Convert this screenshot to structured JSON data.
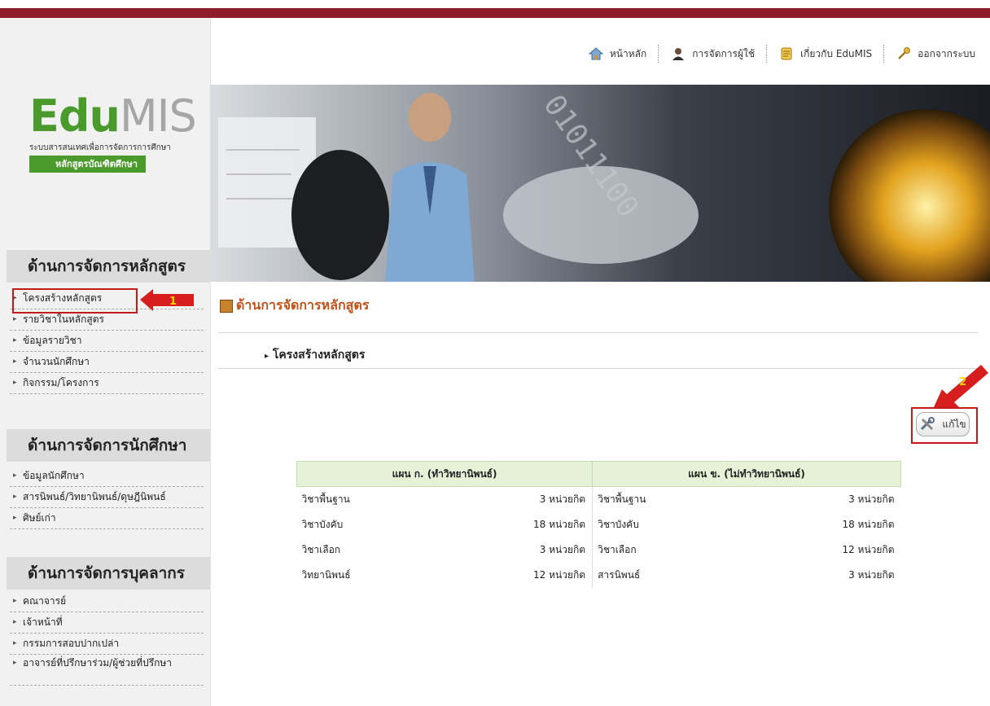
{
  "logo": {
    "brand_a": "Edu",
    "brand_b": "MIS",
    "tagline": "ระบบสารสนเทศเพื่อการจัดการการศึกษา",
    "program": "หลักสูตรบัณฑิตศึกษา"
  },
  "nav": {
    "home": "หน้าหลัก",
    "users": "การจัดการผู้ใช้",
    "about": "เกี่ยวกับ EduMIS",
    "logout": "ออกจากระบบ"
  },
  "sidebar": {
    "sec1": {
      "title": "ด้านการจัดการหลักสูตร",
      "items": [
        "โครงสร้างหลักสูตร",
        "รายวิชาในหลักสูตร",
        "ข้อมูลรายวิชา",
        "จำนวนนักศึกษา",
        "กิจกรรม/โครงการ"
      ]
    },
    "sec2": {
      "title": "ด้านการจัดการนักศึกษา",
      "items": [
        "ข้อมูลนักศึกษา",
        "สารนิพนธ์/วิทยานิพนธ์/ดุษฎีนิพนธ์",
        "ศิษย์เก่า"
      ]
    },
    "sec3": {
      "title": "ด้านการจัดการบุคลากร",
      "items": [
        "คณาจารย์",
        "เจ้าหน้าที่",
        "กรรมการสอบปากเปล่า",
        "อาจารย์ที่ปรึกษาร่วม/ผู้ช่วยที่ปรึกษา"
      ]
    }
  },
  "main": {
    "section_title": "ด้านการจัดการหลักสูตร",
    "subtitle": "โครงสร้างหลักสูตร",
    "edit_label": "แก้ไข"
  },
  "annotations": {
    "one": "1",
    "two": "2"
  },
  "plan_table": {
    "headers": [
      "แผน ก. (ทำวิทยานิพนธ์)",
      "แผน ข. (ไม่ทำวิทยานิพนธ์)"
    ],
    "rows": [
      {
        "a_label": "วิชาพื้นฐาน",
        "a_val": "3 หน่วยกิต",
        "b_label": "วิชาพื้นฐาน",
        "b_val": "3 หน่วยกิต"
      },
      {
        "a_label": "วิชาบังคับ",
        "a_val": "18 หน่วยกิต",
        "b_label": "วิชาบังคับ",
        "b_val": "18 หน่วยกิต"
      },
      {
        "a_label": "วิชาเลือก",
        "a_val": "3 หน่วยกิต",
        "b_label": "วิชาเลือก",
        "b_val": "12 หน่วยกิต"
      },
      {
        "a_label": "วิทยานิพนธ์",
        "a_val": "12 หน่วยกิต",
        "b_label": "สารนิพนธ์",
        "b_val": "3 หน่วยกิต"
      }
    ]
  },
  "colors": {
    "topbar": "#8f1b2b",
    "brand_green": "#4a9a2c",
    "accent_orange": "#c0521a",
    "annotation_red": "#c31a1a"
  }
}
